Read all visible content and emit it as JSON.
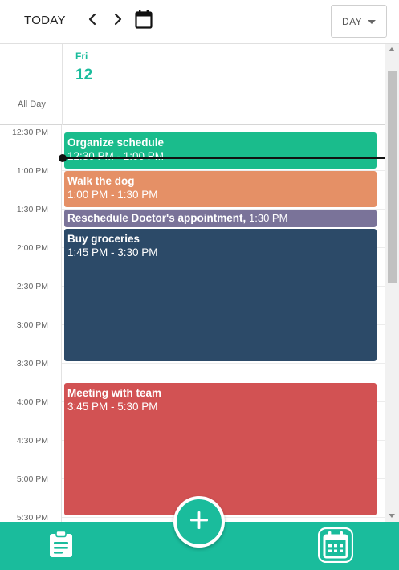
{
  "toolbar": {
    "today_label": "TODAY",
    "prev_icon": "chevron-left-icon",
    "next_icon": "chevron-right-icon",
    "calendar_icon": "calendar-icon",
    "view_selected": "DAY"
  },
  "day_header": {
    "all_day_label": "All Day",
    "day_name": "Fri",
    "day_number": "12"
  },
  "time_labels": [
    "12:30 PM",
    "1:00 PM",
    "1:30 PM",
    "2:00 PM",
    "2:30 PM",
    "3:00 PM",
    "3:30 PM",
    "4:00 PM",
    "4:30 PM",
    "5:00 PM",
    "5:30 PM"
  ],
  "events": [
    {
      "title": "Organize schedule",
      "time": "12:30 PM  -  1:00 PM",
      "color": "#1abc8c"
    },
    {
      "title": "Walk the dog",
      "time": "1:00 PM  -  1:30 PM",
      "color": "#e59066"
    },
    {
      "title": "Reschedule Doctor's appointment,",
      "time": "1:30 PM",
      "color": "#7a7399"
    },
    {
      "title": "Buy groceries",
      "time": "1:45 PM  -  3:30 PM",
      "color": "#2c4a68"
    },
    {
      "title": "Meeting with team",
      "time": "3:45 PM  -  5:30 PM",
      "color": "#d25253"
    }
  ],
  "bottom_bar": {
    "tasks_icon": "clipboard-icon",
    "add_icon": "plus-icon",
    "calendar_icon": "calendar-icon"
  },
  "colors": {
    "accent": "#1abc9c",
    "now_indicator": "#111111"
  }
}
